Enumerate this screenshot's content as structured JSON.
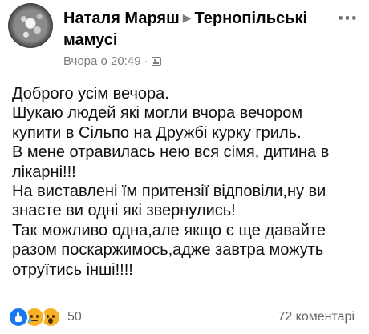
{
  "post": {
    "author": "Наталя Маряш",
    "group": "Тернопільські мамусі",
    "timestamp": "Вчора о 20:49",
    "separator": "·",
    "privacy_icon": "group-privacy-icon",
    "more_icon": "more-options-icon",
    "text_lines": [
      "Доброго усім вечора.",
      "Шукаю людей які могли вчора вечором",
      "купити в Сільпо на Дружбі курку гриль.",
      "В мене отравилась нею вся сімя, дитина в",
      "лікарні!!!",
      "На виставлені їм притензії відповіли,ну ви",
      "знаєте ви одні які звернулись!",
      "Так можливо одна,але якщо є ще давайте",
      "разом поскаржимось,адже завтра можуть",
      "отруїтись інші!!!!"
    ]
  },
  "footer": {
    "reactions": [
      "like",
      "sad",
      "wow"
    ],
    "reaction_count": "50",
    "comments": "72 коментарі"
  },
  "colors": {
    "like": "#1877f2",
    "sad": "#f7b125",
    "wow": "#f7b125",
    "meta_text": "#65676b"
  }
}
